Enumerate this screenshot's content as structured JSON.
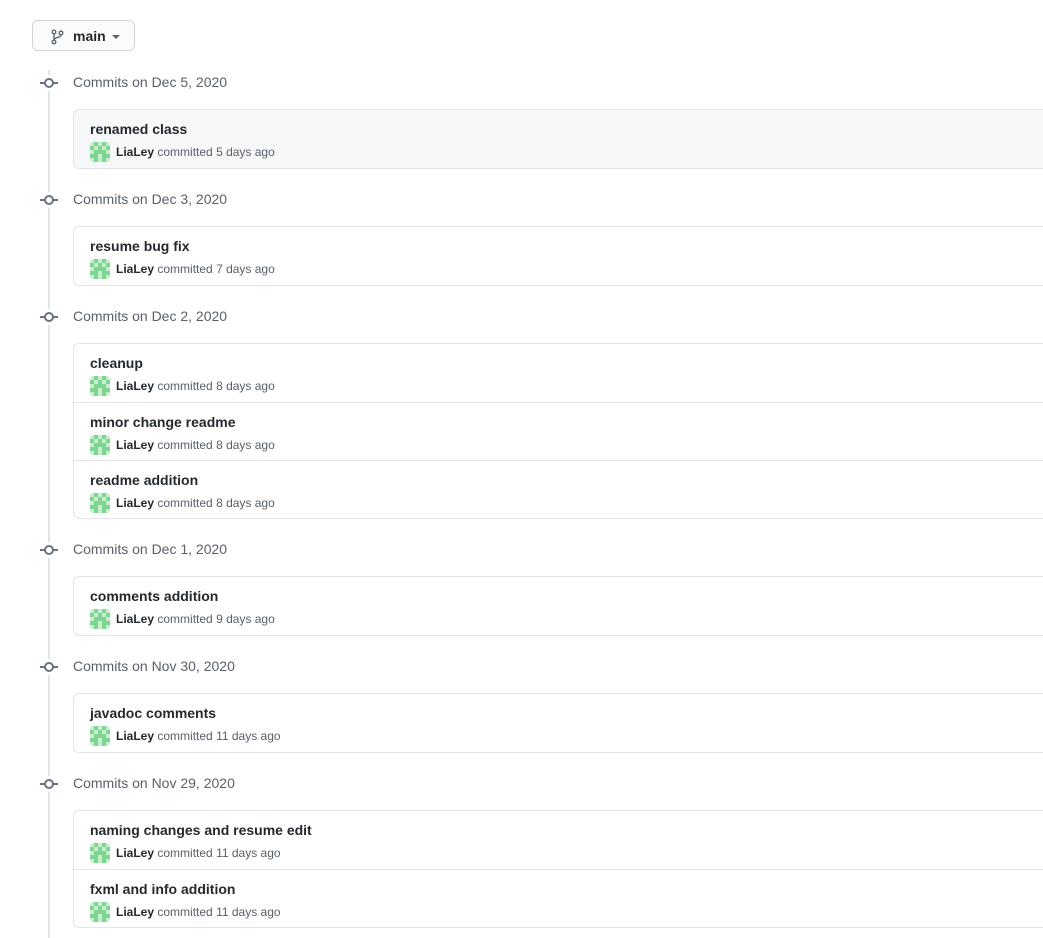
{
  "branch": {
    "label": "main",
    "icon": "git-branch-icon"
  },
  "groups": [
    {
      "title": "Commits on Dec 5, 2020",
      "commits": [
        {
          "message": "renamed class",
          "author": "LiaLey",
          "verb": "committed",
          "time": "5 days ago"
        }
      ]
    },
    {
      "title": "Commits on Dec 3, 2020",
      "commits": [
        {
          "message": "resume bug fix",
          "author": "LiaLey",
          "verb": "committed",
          "time": "7 days ago"
        }
      ]
    },
    {
      "title": "Commits on Dec 2, 2020",
      "commits": [
        {
          "message": "cleanup",
          "author": "LiaLey",
          "verb": "committed",
          "time": "8 days ago"
        },
        {
          "message": "minor change readme",
          "author": "LiaLey",
          "verb": "committed",
          "time": "8 days ago"
        },
        {
          "message": "readme addition",
          "author": "LiaLey",
          "verb": "committed",
          "time": "8 days ago"
        }
      ]
    },
    {
      "title": "Commits on Dec 1, 2020",
      "commits": [
        {
          "message": "comments addition",
          "author": "LiaLey",
          "verb": "committed",
          "time": "9 days ago"
        }
      ]
    },
    {
      "title": "Commits on Nov 30, 2020",
      "commits": [
        {
          "message": "javadoc comments",
          "author": "LiaLey",
          "verb": "committed",
          "time": "11 days ago"
        }
      ]
    },
    {
      "title": "Commits on Nov 29, 2020",
      "commits": [
        {
          "message": "naming changes and resume edit",
          "author": "LiaLey",
          "verb": "committed",
          "time": "11 days ago"
        },
        {
          "message": "fxml and info addition",
          "author": "LiaLey",
          "verb": "committed",
          "time": "11 days ago"
        }
      ]
    }
  ],
  "colors": {
    "avatar_green": "#7ed491",
    "avatar_light": "#c8eecf",
    "timeline": "#e1e4e8",
    "border": "#e1e4e8"
  }
}
